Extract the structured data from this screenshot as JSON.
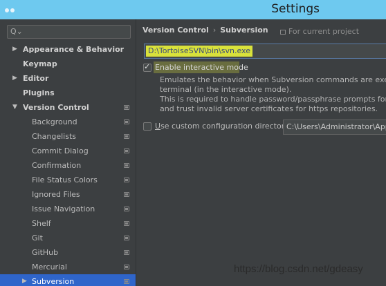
{
  "window": {
    "title": "Settings"
  },
  "sidebar": {
    "search_placeholder": "",
    "items": [
      {
        "label": "Appearance & Behavior",
        "level": 0,
        "expandable": true,
        "expanded": false,
        "project_icon": false
      },
      {
        "label": "Keymap",
        "level": 0,
        "expandable": false,
        "project_icon": false
      },
      {
        "label": "Editor",
        "level": 0,
        "expandable": true,
        "expanded": false,
        "project_icon": false
      },
      {
        "label": "Plugins",
        "level": 0,
        "expandable": false,
        "project_icon": false
      },
      {
        "label": "Version Control",
        "level": 0,
        "expandable": true,
        "expanded": true,
        "project_icon": true
      },
      {
        "label": "Background",
        "level": 1,
        "project_icon": true
      },
      {
        "label": "Changelists",
        "level": 1,
        "project_icon": true
      },
      {
        "label": "Commit Dialog",
        "level": 1,
        "project_icon": true
      },
      {
        "label": "Confirmation",
        "level": 1,
        "project_icon": true
      },
      {
        "label": "File Status Colors",
        "level": 1,
        "project_icon": true
      },
      {
        "label": "Ignored Files",
        "level": 1,
        "project_icon": true
      },
      {
        "label": "Issue Navigation",
        "level": 1,
        "project_icon": true
      },
      {
        "label": "Shelf",
        "level": 1,
        "project_icon": true
      },
      {
        "label": "Git",
        "level": 1,
        "project_icon": true
      },
      {
        "label": "GitHub",
        "level": 1,
        "project_icon": true
      },
      {
        "label": "Mercurial",
        "level": 1,
        "project_icon": true
      },
      {
        "label": "Subversion",
        "level": 1,
        "expandable": true,
        "selected": true,
        "project_icon": true
      }
    ]
  },
  "content": {
    "breadcrumb": {
      "parent": "Version Control",
      "separator": "›",
      "current": "Subversion"
    },
    "scope_label": "For current project",
    "svn_path_value": "D:\\TortoiseSVN\\bin\\svn.exe",
    "interactive_mode": {
      "checked": true,
      "label": "Enable interactive mode"
    },
    "description_lines": [
      "Emulates the behavior when Subversion commands are executed d",
      "terminal (in the interactive mode).",
      "This is required to handle password/passphrase prompts for svn+",
      "and trust invalid server certificates for https repositories."
    ],
    "custom_config": {
      "checked": false,
      "label_mnemonic": "U",
      "label_rest": "se custom configuration directory:",
      "directory_value": "C:\\Users\\Administrator\\AppD"
    }
  },
  "watermark": "https://blog.csdn.net/gdeasy",
  "colors": {
    "titlebar": "#6ec9ef",
    "background": "#3c3f41",
    "selection": "#2f65ca",
    "highlight": "#d9e23b"
  }
}
